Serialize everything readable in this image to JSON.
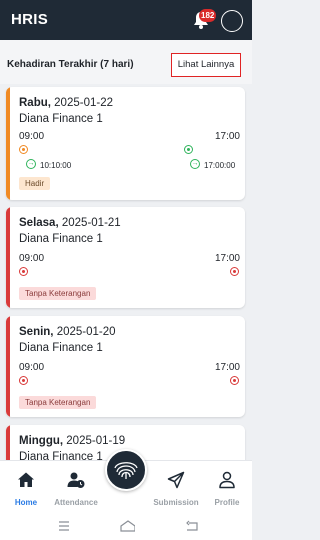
{
  "header": {
    "app_title": "HRIS",
    "notification_count": "182"
  },
  "section": {
    "title": "Kehadiran Terakhir (7 hari)",
    "more_label": "Lihat Lainnya"
  },
  "attendance": [
    {
      "day": "Rabu,",
      "date": "2025-01-22",
      "site": "Diana Finance 1",
      "time_in": "09:00",
      "time_out": "17:00",
      "clock_in": "10:10:00",
      "clock_out": "17:00:00",
      "status": "Hadir"
    },
    {
      "day": "Selasa,",
      "date": "2025-01-21",
      "site": "Diana Finance 1",
      "time_in": "09:00",
      "time_out": "17:00",
      "status": "Tanpa Keterangan"
    },
    {
      "day": "Senin,",
      "date": "2025-01-20",
      "site": "Diana Finance 1",
      "time_in": "09:00",
      "time_out": "17:00",
      "status": "Tanpa Keterangan"
    },
    {
      "day": "Minggu,",
      "date": "2025-01-19",
      "site": "Diana Finance 1"
    }
  ],
  "nav": {
    "home": "Home",
    "attendance": "Attendance",
    "submission": "Submission",
    "profile": "Profile"
  },
  "colors": {
    "header_bg": "#1f2a36",
    "present": "#f08a24",
    "absent": "#d93a3a",
    "clocked": "#2fb35b",
    "active_nav": "#2a7be4"
  }
}
